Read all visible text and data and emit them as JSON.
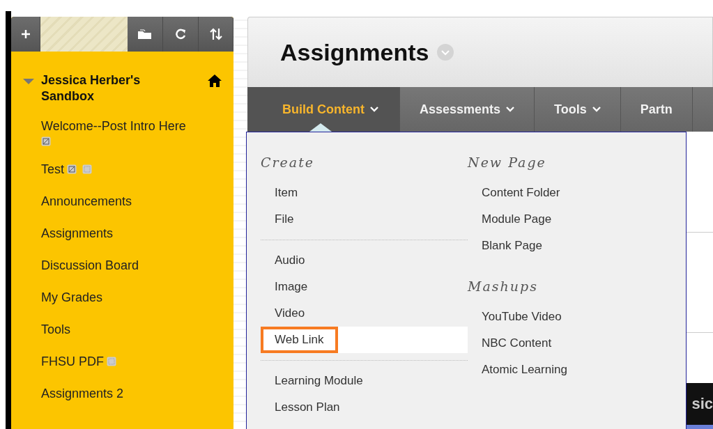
{
  "sidebar": {
    "course": {
      "title": "Jessica Herber's Sandbox",
      "expanded": true,
      "children": [
        {
          "label": "Welcome--Post Intro Here",
          "hidden": true,
          "restricted": false
        },
        {
          "label": "Test",
          "hidden": true,
          "restricted": true
        },
        {
          "label": "Announcements",
          "hidden": false,
          "restricted": false
        },
        {
          "label": "Assignments",
          "hidden": false,
          "restricted": false
        },
        {
          "label": "Discussion Board",
          "hidden": false,
          "restricted": false
        },
        {
          "label": "My Grades",
          "hidden": false,
          "restricted": false
        },
        {
          "label": "Tools",
          "hidden": false,
          "restricted": false
        },
        {
          "label": "FHSU PDF",
          "hidden": false,
          "restricted": true
        },
        {
          "label": "Assignments 2",
          "hidden": false,
          "restricted": false
        }
      ]
    }
  },
  "page": {
    "title": "Assignments"
  },
  "tabs": [
    {
      "label": "Build Content",
      "selected": true
    },
    {
      "label": "Assessments",
      "selected": false
    },
    {
      "label": "Tools",
      "selected": false
    },
    {
      "label": "Partn",
      "selected": false
    }
  ],
  "menu": {
    "columns": [
      {
        "sections": [
          {
            "heading": "Create",
            "groups": [
              [
                {
                  "label": "Item",
                  "selected": false
                },
                {
                  "label": "File",
                  "selected": false
                }
              ],
              [
                {
                  "label": "Audio",
                  "selected": false
                },
                {
                  "label": "Image",
                  "selected": false
                },
                {
                  "label": "Video",
                  "selected": false
                },
                {
                  "label": "Web Link",
                  "selected": true
                }
              ],
              [
                {
                  "label": "Learning Module",
                  "selected": false
                },
                {
                  "label": "Lesson Plan",
                  "selected": false
                }
              ]
            ]
          }
        ]
      },
      {
        "sections": [
          {
            "heading": "New Page",
            "groups": [
              [
                {
                  "label": "Content Folder",
                  "selected": false
                },
                {
                  "label": "Module Page",
                  "selected": false
                },
                {
                  "label": "Blank Page",
                  "selected": false
                }
              ]
            ]
          },
          {
            "heading": "Mashups",
            "groups": [
              [
                {
                  "label": "YouTube Video",
                  "selected": false
                },
                {
                  "label": "NBC Content",
                  "selected": false
                },
                {
                  "label": "Atomic Learning",
                  "selected": false
                }
              ]
            ]
          }
        ]
      }
    ]
  },
  "content": {
    "section_bar": "sic"
  }
}
